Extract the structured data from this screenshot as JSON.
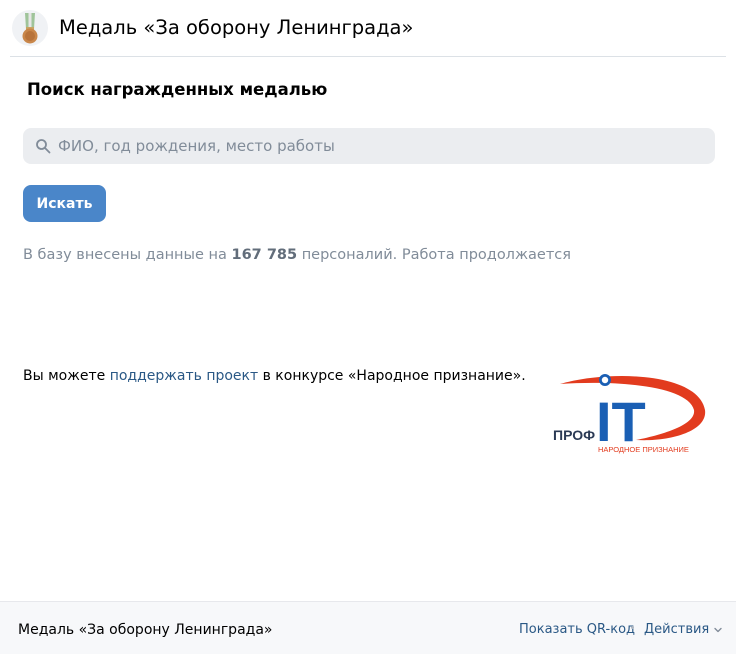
{
  "header": {
    "title": "Медаль «За оборону Ленинграда»",
    "avatar_icon": "medal-icon"
  },
  "search_section": {
    "title": "Поиск награжденных медалью",
    "input": {
      "placeholder": "ФИО, год рождения, место работы",
      "value": ""
    },
    "search_icon": "search-icon",
    "button_label": "Искать"
  },
  "info": {
    "prefix": "В базу внесены данные на ",
    "count": "167 785",
    "suffix": " персоналий. Работа продолжается"
  },
  "support": {
    "prefix": "Вы можете ",
    "link": "поддержать проект",
    "suffix": " в конкурсе «Народное признание».",
    "logo": {
      "left_text": "ПРОФ",
      "big_text": "IT",
      "subtitle": "НАРОДНОЕ ПРИЗНАНИЕ",
      "colors": {
        "blue": "#1a5fb4",
        "red": "#e23b1e"
      }
    }
  },
  "footer": {
    "title": "Медаль «За оборону Ленинграда»",
    "qr_link": "Показать QR-код",
    "actions": "Действия"
  },
  "colors": {
    "accent": "#4a86c9",
    "link": "#2a5885",
    "muted_text": "#818c99",
    "search_bg": "#ebedf0",
    "footer_bg": "#f7f8fa"
  }
}
